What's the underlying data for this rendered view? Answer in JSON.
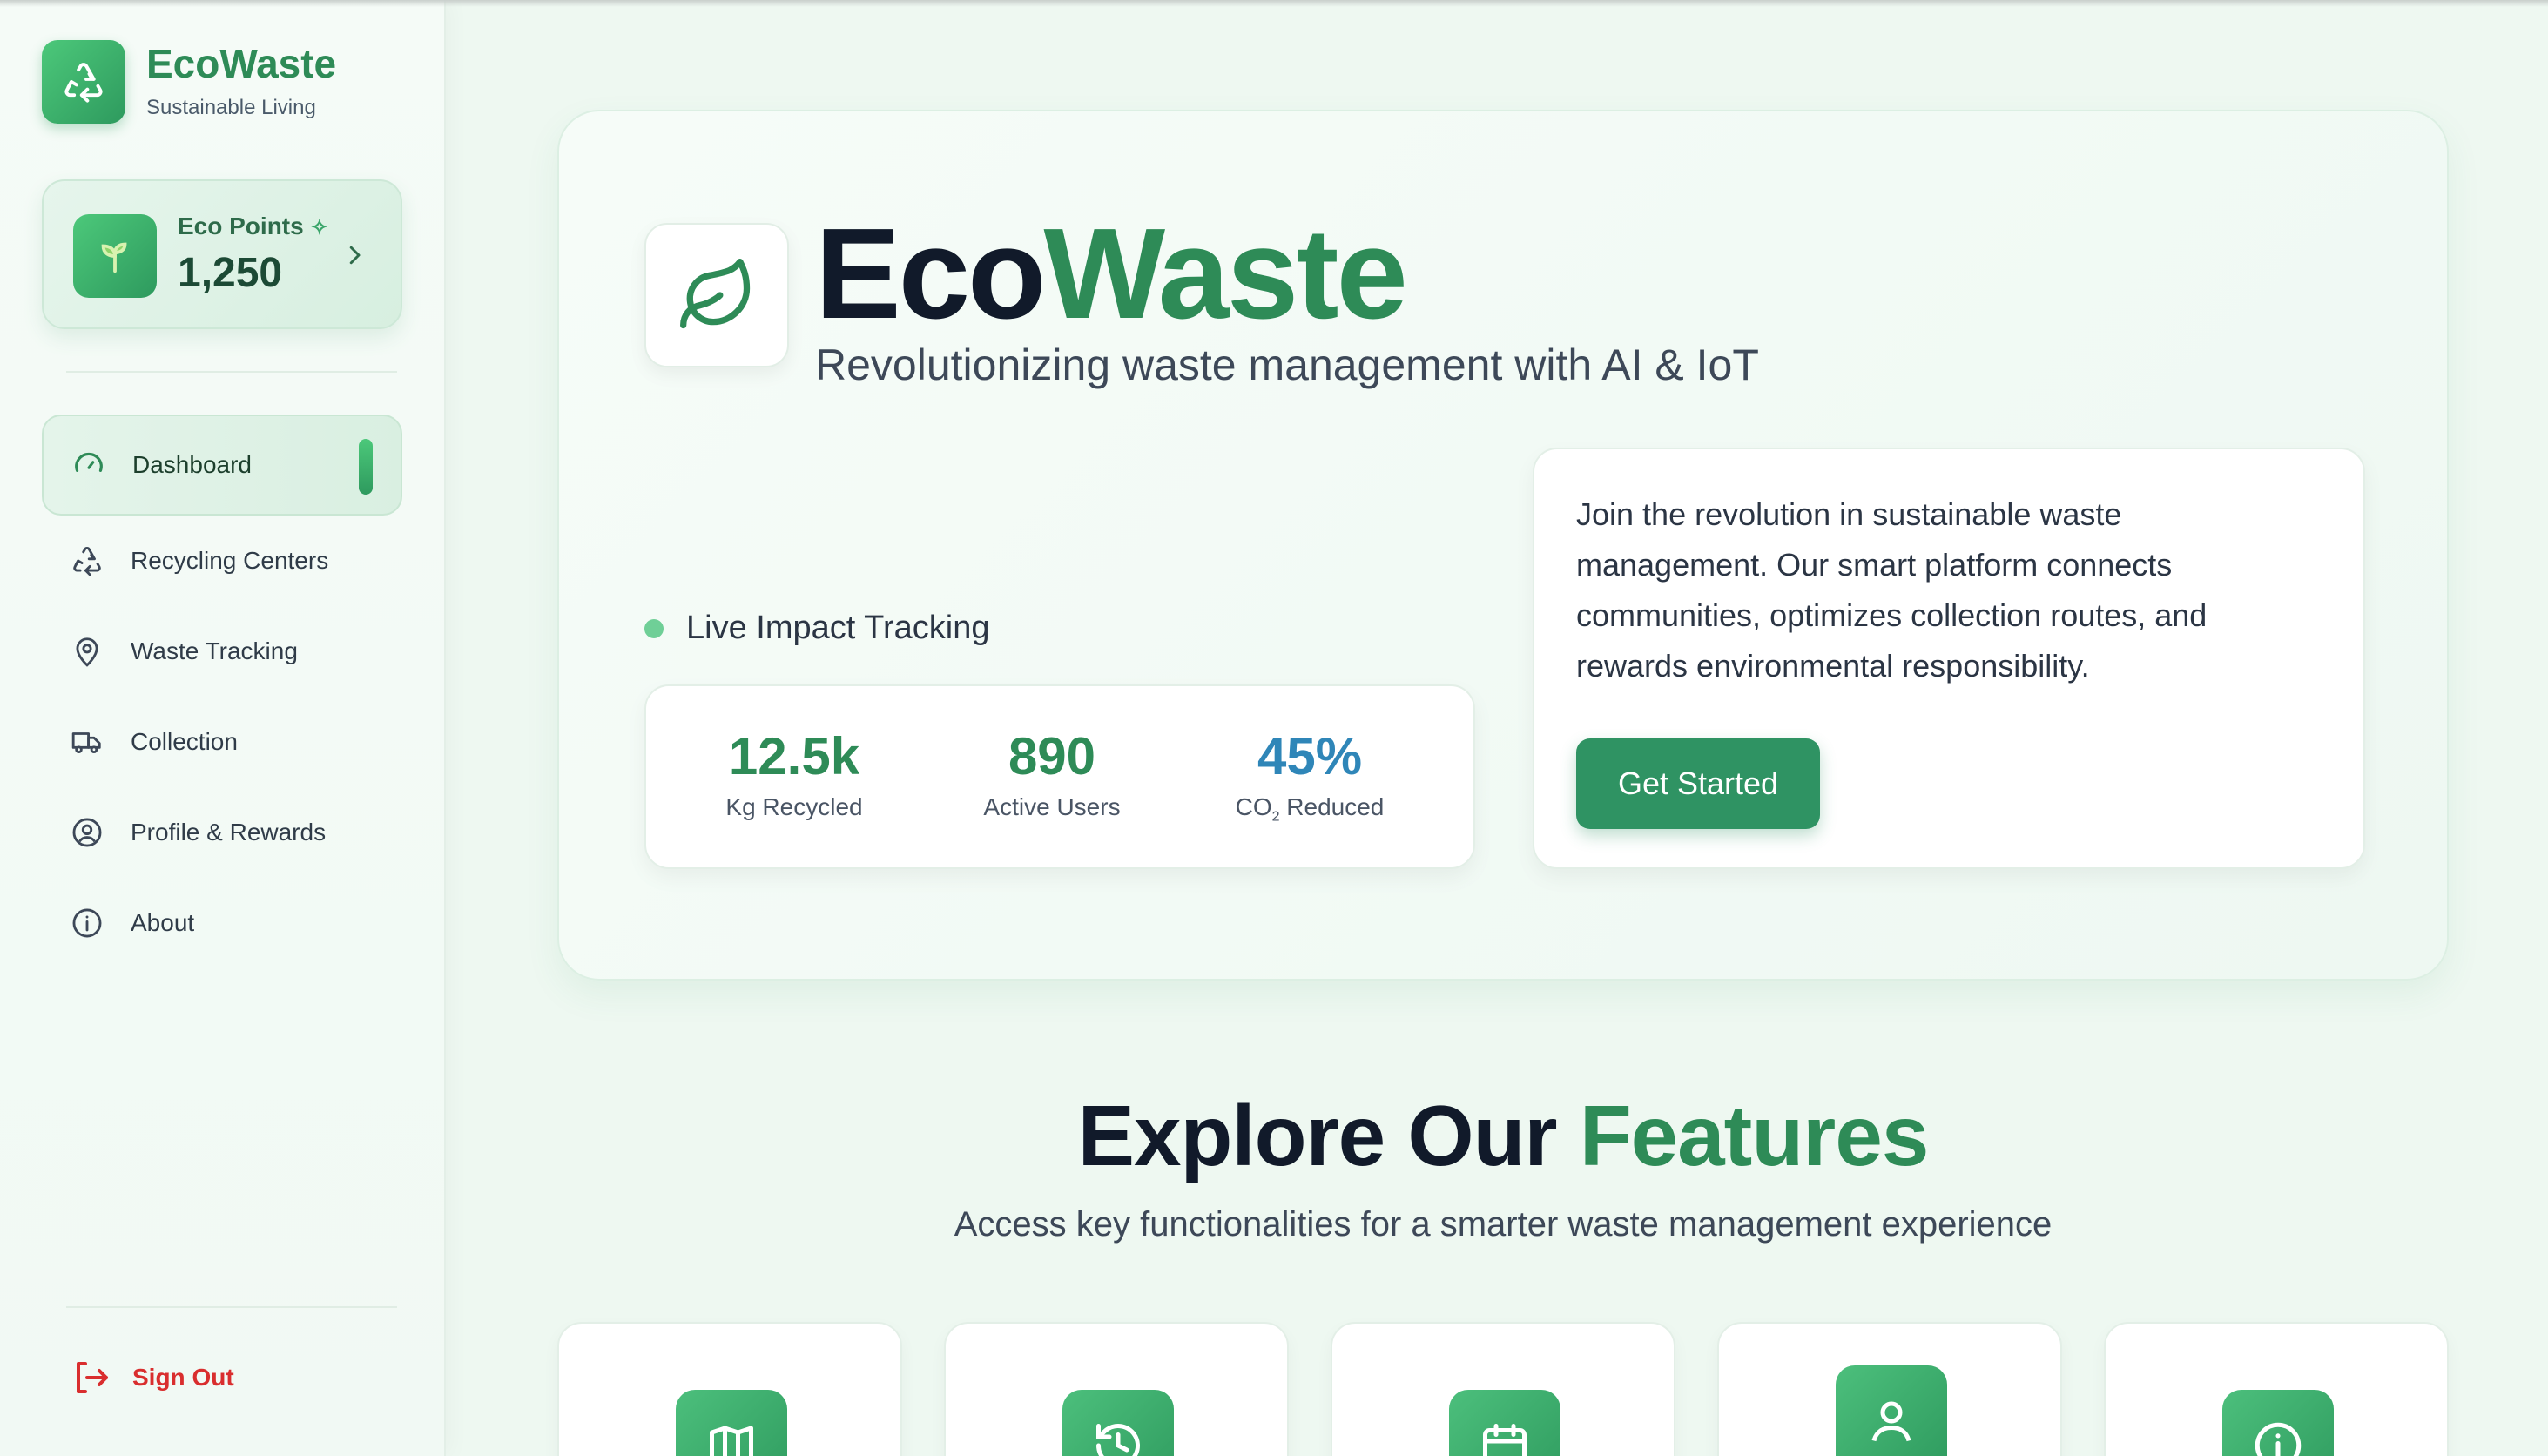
{
  "brand": {
    "title": "EcoWaste",
    "subtitle": "Sustainable Living"
  },
  "points": {
    "label": "Eco Points",
    "value": "1,250"
  },
  "nav": [
    {
      "label": "Dashboard",
      "icon": "gauge-icon",
      "active": true
    },
    {
      "label": "Recycling Centers",
      "icon": "recycle-icon"
    },
    {
      "label": "Waste Tracking",
      "icon": "map-pin-icon"
    },
    {
      "label": "Collection",
      "icon": "truck-icon"
    },
    {
      "label": "Profile & Rewards",
      "icon": "user-circle-icon"
    },
    {
      "label": "About",
      "icon": "info-icon"
    }
  ],
  "signout": {
    "label": "Sign Out"
  },
  "hero": {
    "title_dark": "Eco",
    "title_green": "Waste",
    "subtitle": "Revolutionizing waste management with AI & IoT",
    "live_label": "Live Impact Tracking",
    "stats": [
      {
        "value": "12.5k",
        "label": "Kg Recycled",
        "color": "#2e8b57"
      },
      {
        "value": "890",
        "label": "Active Users",
        "color": "#2e8b57"
      },
      {
        "value": "45%",
        "label_pre": "CO",
        "label_sub": "2",
        "label_post": " Reduced",
        "color": "#2f86b8"
      }
    ],
    "join_text": "Join the revolution in sustainable waste management. Our smart platform connects communities, optimizes collection routes, and rewards environmental responsibility.",
    "cta_label": "Get Started"
  },
  "features": {
    "title_dark": "Explore Our ",
    "title_green": "Features",
    "subtitle": "Access key functionalities for a smarter waste management experience",
    "cards": [
      {
        "icon": "map-icon"
      },
      {
        "icon": "history-icon"
      },
      {
        "icon": "calendar-icon"
      },
      {
        "icon": "user-icon"
      },
      {
        "icon": "info-icon"
      }
    ]
  },
  "colors": {
    "brand_green": "#2e8b57",
    "accent_blue": "#2f86b8",
    "danger": "#d92e2e"
  }
}
